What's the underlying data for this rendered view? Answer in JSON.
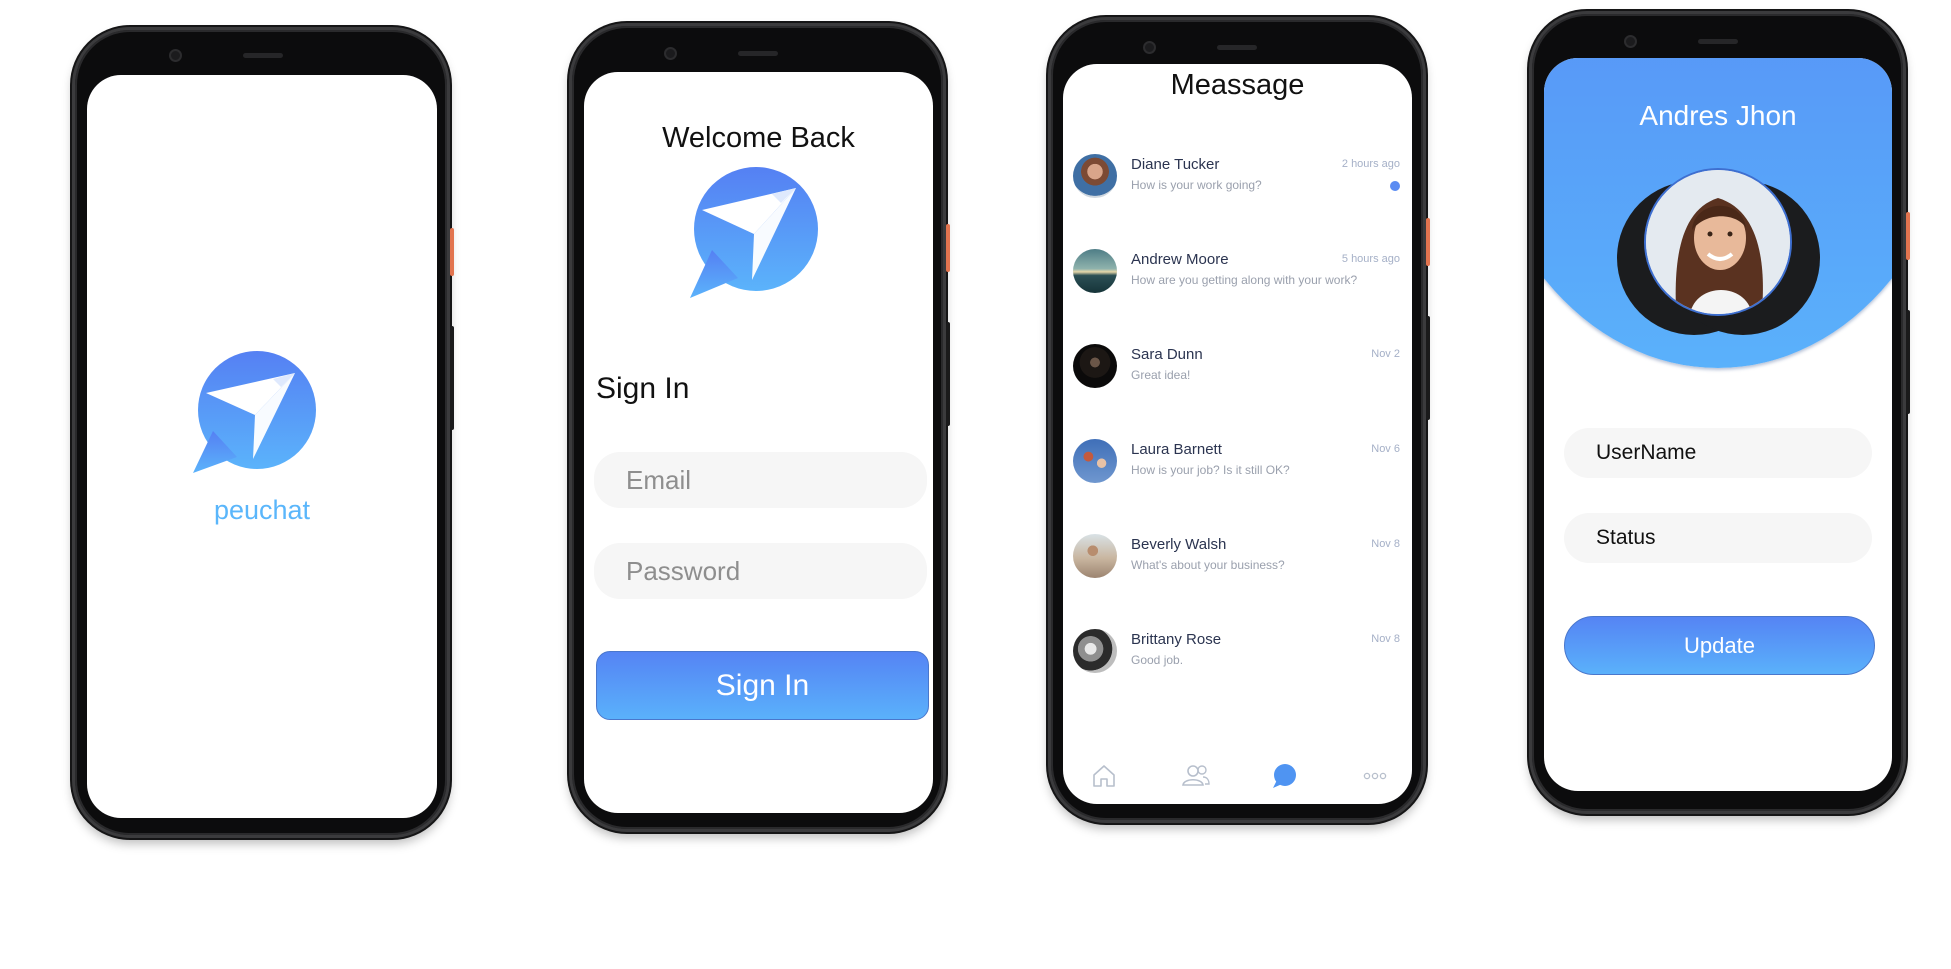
{
  "colors": {
    "brand_gradient_top": "#5584f4",
    "brand_gradient_bottom": "#5ab1fb",
    "brand_text": "#5ab6fb",
    "unread_dot": "#5b8cf2",
    "active_nav": "#4f94f2"
  },
  "splash": {
    "logo_icon": "paper-plane-chat-bubble-icon",
    "brand_name": "peuchat"
  },
  "signin": {
    "title": "Welcome Back",
    "logo_icon": "paper-plane-chat-bubble-icon",
    "heading": "Sign In",
    "email_placeholder": "Email",
    "password_placeholder": "Password",
    "button_label": "Sign In"
  },
  "messages": {
    "title": "Meassage",
    "items": [
      {
        "name": "Diane Tucker",
        "preview": "How is your work going?",
        "time": "2 hours ago",
        "unread": true
      },
      {
        "name": "Andrew Moore",
        "preview": "How are you getting along with your work?",
        "time": "5 hours ago",
        "unread": false
      },
      {
        "name": "Sara Dunn",
        "preview": "Great idea!",
        "time": "Nov 2",
        "unread": false
      },
      {
        "name": "Laura Barnett",
        "preview": "How is your job? Is it still OK?",
        "time": "Nov 6",
        "unread": false
      },
      {
        "name": "Beverly Walsh",
        "preview": "What's about your business?",
        "time": "Nov 8",
        "unread": false
      },
      {
        "name": "Brittany Rose",
        "preview": "Good job.",
        "time": "Nov 8",
        "unread": false
      }
    ],
    "nav": [
      {
        "icon": "home-icon",
        "active": false
      },
      {
        "icon": "contacts-icon",
        "active": false
      },
      {
        "icon": "chat-bubble-icon",
        "active": true
      },
      {
        "icon": "more-dots-icon",
        "active": false
      }
    ]
  },
  "profile": {
    "name": "Andres Jhon",
    "username_placeholder": "UserName",
    "status_placeholder": "Status",
    "button_label": "Update"
  }
}
